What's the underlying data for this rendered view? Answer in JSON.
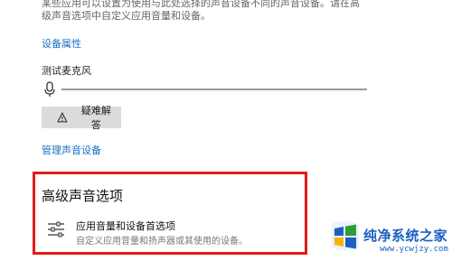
{
  "intro": {
    "line1": "某些应用可以设置为使用与此处选择的声音设备不同的声音设备。请在高",
    "line2": "级声音选项中自定义应用音量和设备。"
  },
  "device_properties_link": "设备属性",
  "test_mic_label": "测试麦克风",
  "troubleshoot_button": "疑难解答",
  "manage_devices_link": "管理声音设备",
  "advanced_section": {
    "title": "高级声音选项",
    "option_title": "应用音量和设备首选项",
    "option_subtitle": "自定义应用音量和扬声器或其使用的设备。"
  },
  "watermark": {
    "name": "纯净系统之家",
    "url": "www.ycwjzy.com"
  },
  "colors": {
    "accent_link": "#1a6fc4",
    "highlight_border": "#e31b1b",
    "watermark_blue": "#1c5fc1",
    "watermark_green": "#2f9e3a"
  },
  "icons": [
    "microphone-icon",
    "warning-icon",
    "sliders-icon",
    "windows-logo-icon"
  ]
}
